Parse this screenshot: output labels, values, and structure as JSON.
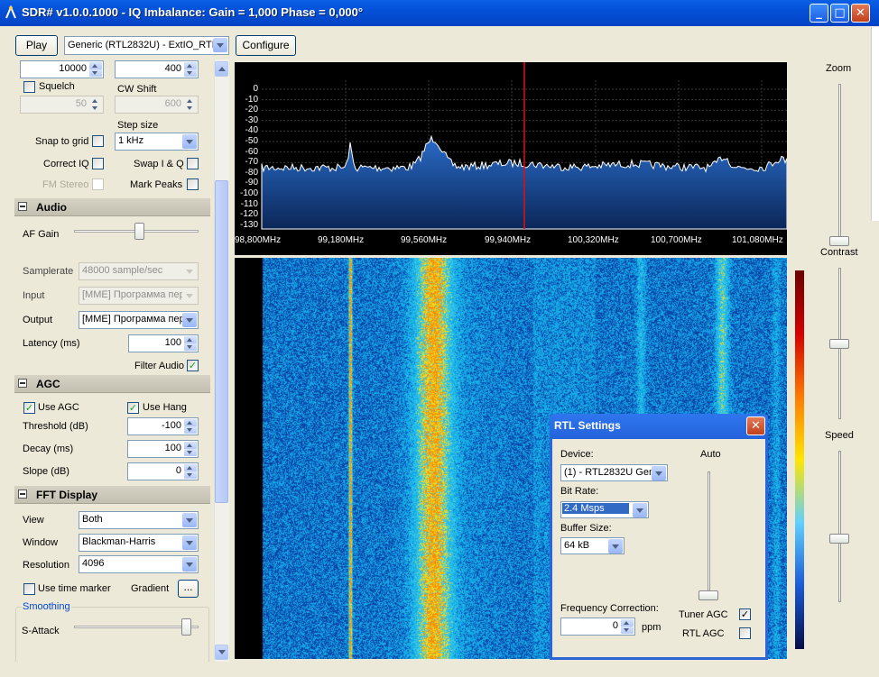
{
  "window": {
    "title": "SDR# v1.0.0.1000 - IQ Imbalance: Gain = 1,000 Phase = 0,000°"
  },
  "toolbar": {
    "play_label": "Play",
    "device_value": "Generic (RTL2832U) - ExtIO_RTL",
    "configure_label": "Configure"
  },
  "radio": {
    "filter_bandwidth": "10000",
    "cw_offset": "400",
    "squelch_label": "Squelch",
    "cw_shift_label": "CW Shift",
    "squelch_value": "50",
    "cw_shift_value": "600",
    "step_size_label": "Step size",
    "snap_to_grid_label": "Snap to grid",
    "step_size_value": "1 kHz",
    "correct_iq_label": "Correct IQ",
    "swap_iq_label": "Swap I & Q",
    "fm_stereo_label": "FM Stereo",
    "mark_peaks_label": "Mark Peaks"
  },
  "audio": {
    "section_label": "Audio",
    "af_gain_label": "AF Gain",
    "af_gain_level": 0.52,
    "samplerate_label": "Samplerate",
    "samplerate_value": "48000 sample/sec",
    "input_label": "Input",
    "input_value": "[MME] Программа пер",
    "output_label": "Output",
    "output_value": "[MME] Программа пер",
    "latency_label": "Latency (ms)",
    "latency_value": "100",
    "filter_audio_label": "Filter Audio"
  },
  "agc": {
    "section_label": "AGC",
    "use_agc_label": "Use AGC",
    "use_hang_label": "Use Hang",
    "threshold_label": "Threshold (dB)",
    "threshold_value": "-100",
    "decay_label": "Decay (ms)",
    "decay_value": "100",
    "slope_label": "Slope (dB)",
    "slope_value": "0"
  },
  "fft": {
    "section_label": "FFT Display",
    "view_label": "View",
    "view_value": "Both",
    "window_label": "Window",
    "window_value": "Blackman-Harris",
    "resolution_label": "Resolution",
    "resolution_value": "4096",
    "use_time_marker_label": "Use  time marker",
    "gradient_label": "Gradient",
    "gradient_button_label": "...",
    "smoothing_label": "Smoothing",
    "s_attack_label": "S-Attack",
    "s_attack_level": 0.9
  },
  "spectrum": {
    "db_labels": [
      "0",
      "-10",
      "-20",
      "-30",
      "-40",
      "-50",
      "-60",
      "-70",
      "-80",
      "-90",
      "-100",
      "-110",
      "-120",
      "-130"
    ],
    "freq_labels": [
      "98,800MHz",
      "99,180MHz",
      "99,560MHz",
      "99,940MHz",
      "100,320MHz",
      "100,700MHz",
      "101,080MHz"
    ]
  },
  "right_panel": {
    "zoom_label": "Zoom",
    "contrast_label": "Contrast",
    "speed_label": "Speed",
    "zoom_level": 0.0,
    "contrast_level": 0.5,
    "speed_level": 0.42
  },
  "rtl_dialog": {
    "title": "RTL Settings",
    "device_label": "Device:",
    "device_value": "(1) - RTL2832U Gene",
    "bit_rate_label": "Bit Rate:",
    "bit_rate_value": "2.4 Msps",
    "buffer_size_label": "Buffer Size:",
    "buffer_size_value": "64 kB",
    "auto_label": "Auto",
    "freq_correction_label": "Frequency Correction:",
    "freq_correction_value": "0",
    "ppm_label": "ppm",
    "tuner_agc_label": "Tuner AGC",
    "rtl_agc_label": "RTL AGC"
  },
  "colors": {
    "titlebar": "#0451d8",
    "spectrum_fill": "#1c5fb8",
    "marker": "#e01010"
  }
}
